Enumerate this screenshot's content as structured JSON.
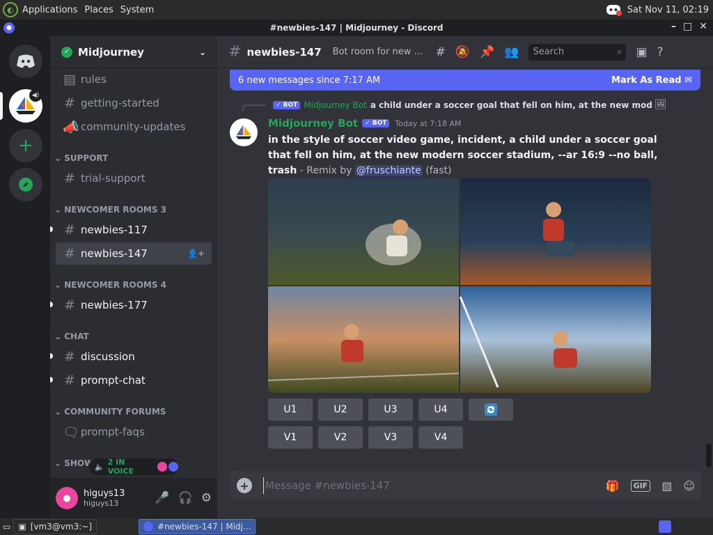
{
  "os": {
    "menus": [
      "Applications",
      "Places",
      "System"
    ],
    "datetime": "Sat Nov 11, 02:19"
  },
  "window": {
    "title": "#newbies-147 | Midjourney - Discord"
  },
  "server": {
    "name": "Midjourney"
  },
  "sidebar": {
    "channels_top": [
      "rules",
      "getting-started",
      "community-updates"
    ],
    "categories": {
      "support": "SUPPORT",
      "newcomer3": "NEWCOMER ROOMS 3",
      "newcomer4": "NEWCOMER ROOMS 4",
      "chat": "CHAT",
      "forums": "COMMUNITY FORUMS",
      "show": "SHOWC"
    },
    "support_channels": [
      "trial-support"
    ],
    "newcomer3_channels": [
      "newbies-117",
      "newbies-147"
    ],
    "newcomer4_channels": [
      "newbies-177"
    ],
    "chat_channels": [
      "discussion",
      "prompt-chat"
    ],
    "forum_channels": [
      "prompt-faqs"
    ],
    "voice_pill": "2 IN VOICE"
  },
  "user": {
    "name": "higuys13",
    "tag": "higuys13"
  },
  "channel": {
    "name": "newbies-147",
    "topic": "Bot room for new us...",
    "search_placeholder": "Search"
  },
  "banner": {
    "text": "6 new messages since 7:17 AM",
    "action": "Mark As Read"
  },
  "message": {
    "reply_author": "Midjourney Bot",
    "reply_text": "a child under a soccer goal that fell on him, at the new modern s",
    "author": "Midjourney Bot",
    "bot_badge": "✓ BOT",
    "timestamp": "Today at 7:18 AM",
    "prompt": "in the style of soccer video game, incident, a child under a soccer goal that fell on him, at the new modern soccer stadium, --ar 16:9 --no ball, trash",
    "remix": " - Remix by ",
    "mention": "@fruschiante",
    "speed": " (fast)",
    "upscale_buttons": [
      "U1",
      "U2",
      "U3",
      "U4"
    ],
    "variation_buttons": [
      "V1",
      "V2",
      "V3",
      "V4"
    ]
  },
  "composer": {
    "placeholder": "Message #newbies-147"
  },
  "taskbar": {
    "items": [
      "[vm3@vm3:~]",
      "#newbies-147 | Midj..."
    ]
  },
  "colors": {
    "accent": "#5865f2",
    "online": "#23a55a"
  }
}
